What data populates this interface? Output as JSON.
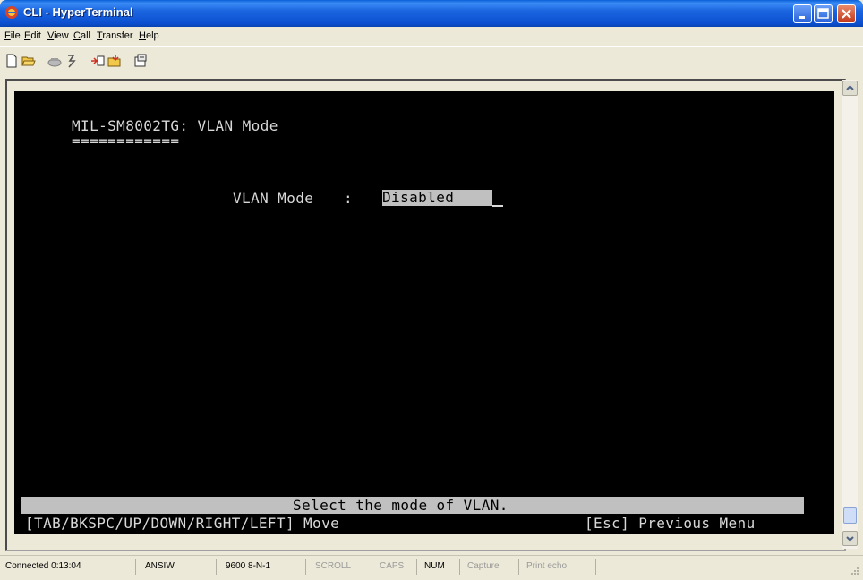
{
  "window": {
    "title": "CLI - HyperTerminal",
    "icon": "hyperterminal-icon"
  },
  "title_buttons": [
    "minimize",
    "maximize",
    "close"
  ],
  "menu": [
    {
      "label": "File",
      "underline": "F"
    },
    {
      "label": "Edit",
      "underline": "E"
    },
    {
      "label": "View",
      "underline": "V"
    },
    {
      "label": "Call",
      "underline": "C"
    },
    {
      "label": "Transfer",
      "underline": "T"
    },
    {
      "label": "Help",
      "underline": "H"
    }
  ],
  "toolbar": [
    "new-icon",
    "open-icon",
    "disconnect-icon",
    "dial-icon",
    "send-icon",
    "receive-icon",
    "properties-icon"
  ],
  "terminal": {
    "header": "MIL-SM8002TG: VLAN Mode",
    "underline": "============",
    "field_label": "VLAN Mode",
    "field_sep": ":",
    "field_value": "Disabled",
    "hint": "Select the mode of VLAN.",
    "keys_left": "[TAB/BKSPC/UP/DOWN/RIGHT/LEFT] Move",
    "keys_right": "[Esc] Previous Menu"
  },
  "statusbar": {
    "connected": "Connected 0:13:04",
    "emulation": "ANSIW",
    "settings": "9600 8-N-1",
    "scroll": "SCROLL",
    "caps": "CAPS",
    "num": "NUM",
    "capture": "Capture",
    "print_echo": "Print echo"
  }
}
